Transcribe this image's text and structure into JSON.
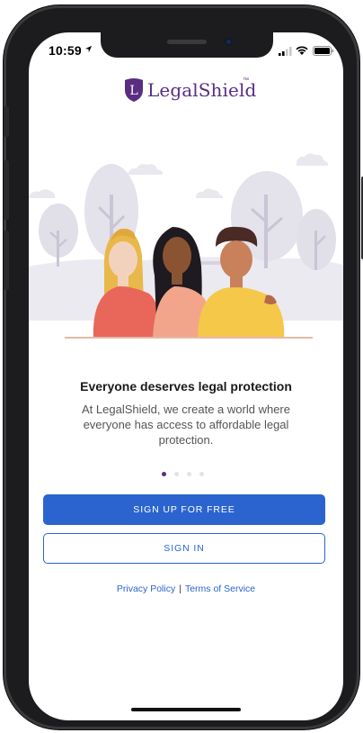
{
  "status_bar": {
    "time": "10:59",
    "icons": [
      "location-arrow-icon",
      "signal-icon",
      "wifi-icon",
      "battery-icon"
    ]
  },
  "brand": {
    "name": "LegalShield",
    "trademark": "™",
    "monogram": "L",
    "color": "#5a2d82"
  },
  "onboarding": {
    "headline": "Everyone deserves legal protection",
    "subtext": "At LegalShield, we create a world where everyone has access to affordable legal protection.",
    "page_count": 4,
    "active_page": 1
  },
  "actions": {
    "signup_label": "SIGN UP FOR FREE",
    "signin_label": "SIGN IN"
  },
  "footer": {
    "privacy_label": "Privacy Policy",
    "separator": "|",
    "terms_label": "Terms of Service"
  },
  "colors": {
    "primary": "#2b64cf",
    "brand_purple": "#5a2d82",
    "dot_active": "#5a2d82",
    "dot_inactive": "#e3e3e6"
  }
}
